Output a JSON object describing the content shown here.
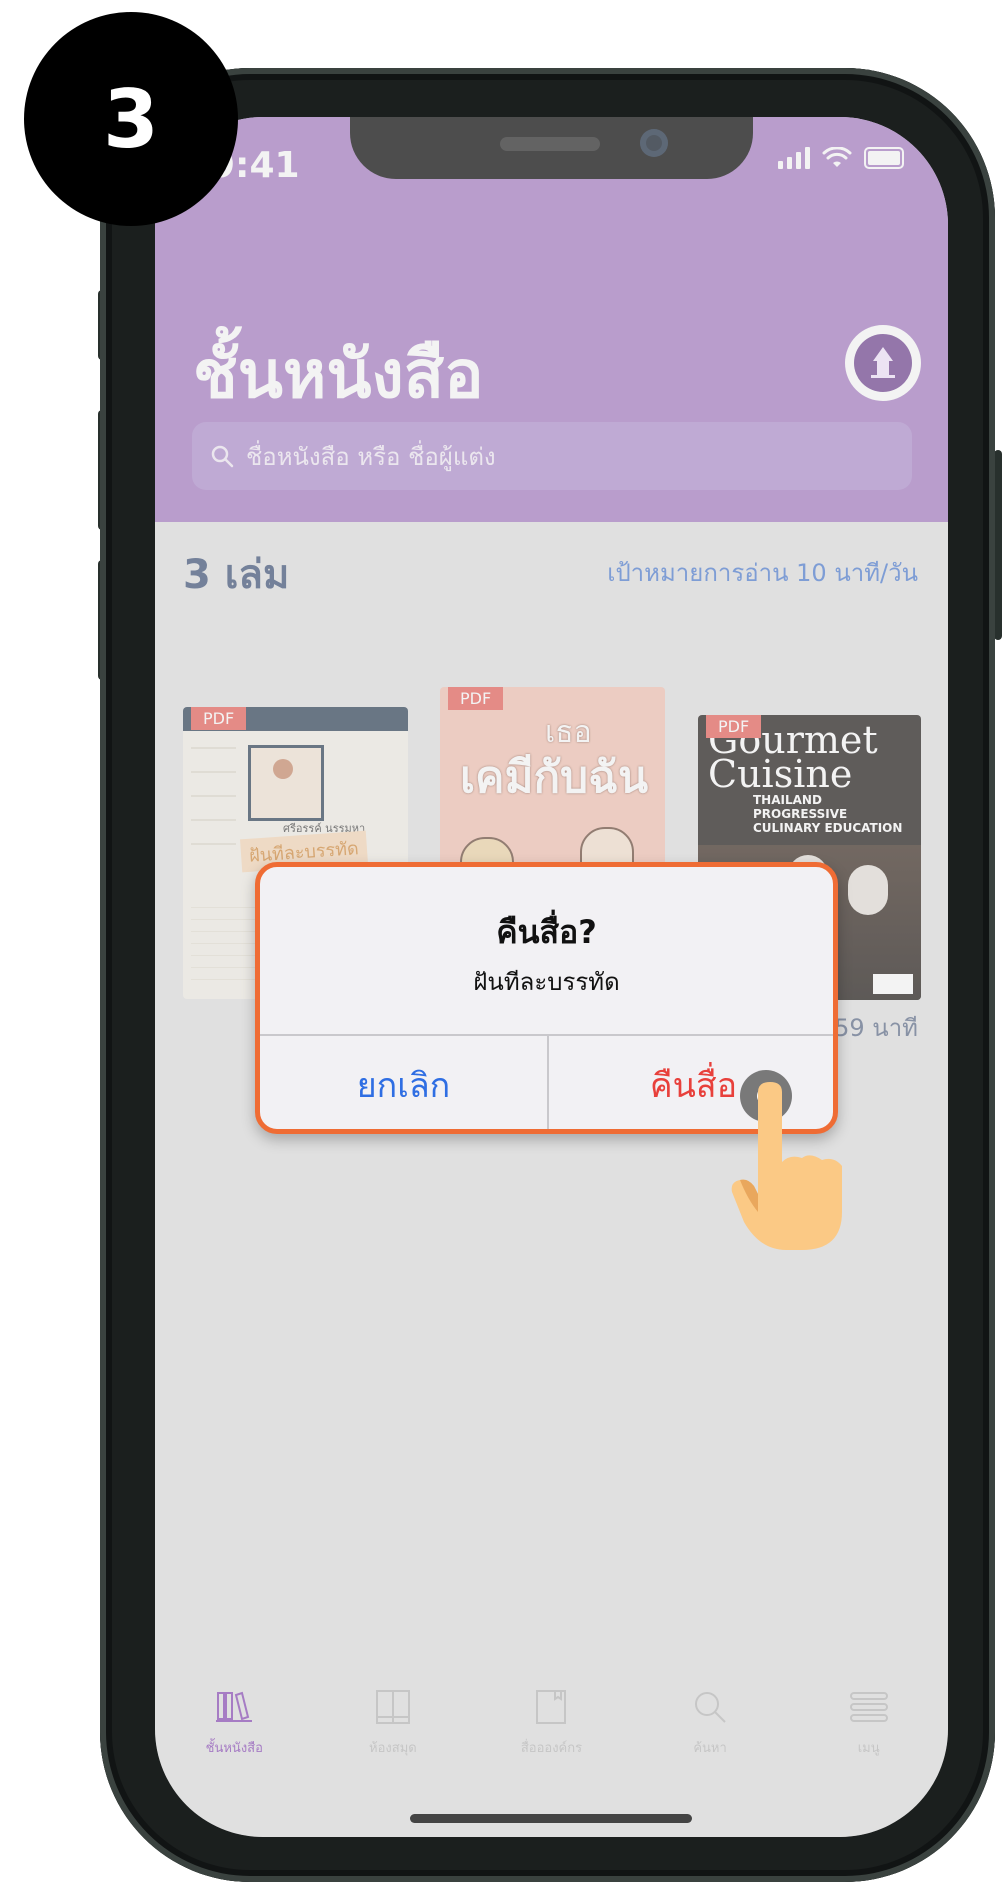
{
  "step_badge": "3",
  "status_bar": {
    "time": "9:41"
  },
  "header": {
    "title": "ชั้นหนังสือ",
    "search_placeholder": "ชื่อหนังสือ หรือ ชื่อผู้แต่ง",
    "avatar_icon": "university-logo-icon"
  },
  "shelf": {
    "count_label": "3 เล่ม",
    "goal_label": "เป้าหมายการอ่าน 10 นาที/วัน",
    "books": [
      {
        "tag": "PDF",
        "cover_text": "ฝันทีละบรรทัด",
        "cover_subtext": "ศรีอรรค์ นรรมหา"
      },
      {
        "tag": "PDF",
        "cover_text": "เคมีกับฉัน",
        "cover_subtext": "เธอ"
      },
      {
        "tag": "PDF",
        "cover_text": "Gourmet Cuisine",
        "cover_subtext": "THAILAND PROGRESSIVE CULINARY EDUCATION",
        "time_left": "59 นาที"
      }
    ]
  },
  "dialog": {
    "title": "คืนสื่อ?",
    "message": "ฝันทีละบรรทัด",
    "cancel_label": "ยกเลิก",
    "confirm_label": "คืนสื่อ"
  },
  "tabbar": {
    "items": [
      {
        "label": "ชั้นหนังสือ",
        "icon": "bookshelf-icon",
        "active": true
      },
      {
        "label": "ห้องสมุด",
        "icon": "library-icon",
        "active": false
      },
      {
        "label": "สื่ออองค์กร",
        "icon": "book-icon",
        "active": false
      },
      {
        "label": "ค้นหา",
        "icon": "search-icon",
        "active": false
      },
      {
        "label": "เมนู",
        "icon": "menu-icon",
        "active": false
      }
    ]
  },
  "colors": {
    "header": "#a67cc4",
    "dialog_border": "#ef6c34",
    "cancel": "#2f6ee3",
    "confirm": "#e8403b"
  }
}
